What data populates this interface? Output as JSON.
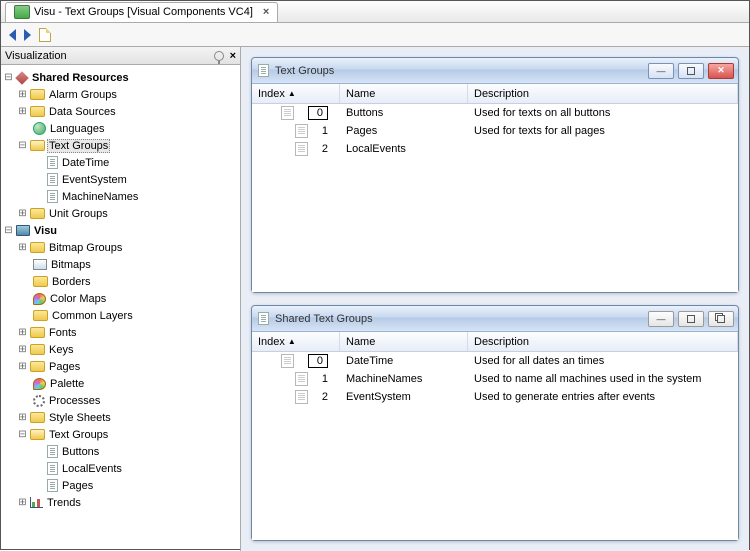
{
  "tab": {
    "title": "Visu - Text Groups [Visual Components VC4]"
  },
  "sidebar": {
    "title": "Visualization",
    "root1": "Shared Resources",
    "root2": "Visu",
    "sr": {
      "alarm": "Alarm Groups",
      "data": "Data Sources",
      "lang": "Languages",
      "tg": "Text Groups",
      "tg_items": {
        "dt": "DateTime",
        "ev": "EventSystem",
        "mn": "MachineNames"
      },
      "unit": "Unit Groups"
    },
    "visu": {
      "bmpg": "Bitmap Groups",
      "bmp": "Bitmaps",
      "bord": "Borders",
      "cmap": "Color Maps",
      "clay": "Common Layers",
      "fonts": "Fonts",
      "keys": "Keys",
      "pages": "Pages",
      "pal": "Palette",
      "proc": "Processes",
      "ss": "Style Sheets",
      "tg": "Text Groups",
      "tg_items": {
        "btn": "Buttons",
        "le": "LocalEvents",
        "pg": "Pages"
      },
      "trends": "Trends"
    }
  },
  "cols": {
    "index": "Index",
    "name": "Name",
    "desc": "Description"
  },
  "win1": {
    "title": "Text Groups",
    "rows": [
      {
        "idx": "0",
        "name": "Buttons",
        "desc": "Used for texts on all buttons"
      },
      {
        "idx": "1",
        "name": "Pages",
        "desc": "Used for texts for all pages"
      },
      {
        "idx": "2",
        "name": "LocalEvents",
        "desc": ""
      }
    ]
  },
  "win2": {
    "title": "Shared Text Groups",
    "rows": [
      {
        "idx": "0",
        "name": "DateTime",
        "desc": "Used for all dates an times"
      },
      {
        "idx": "1",
        "name": "MachineNames",
        "desc": "Used to name all machines used in the system"
      },
      {
        "idx": "2",
        "name": "EventSystem",
        "desc": "Used to generate entries after events"
      }
    ]
  }
}
